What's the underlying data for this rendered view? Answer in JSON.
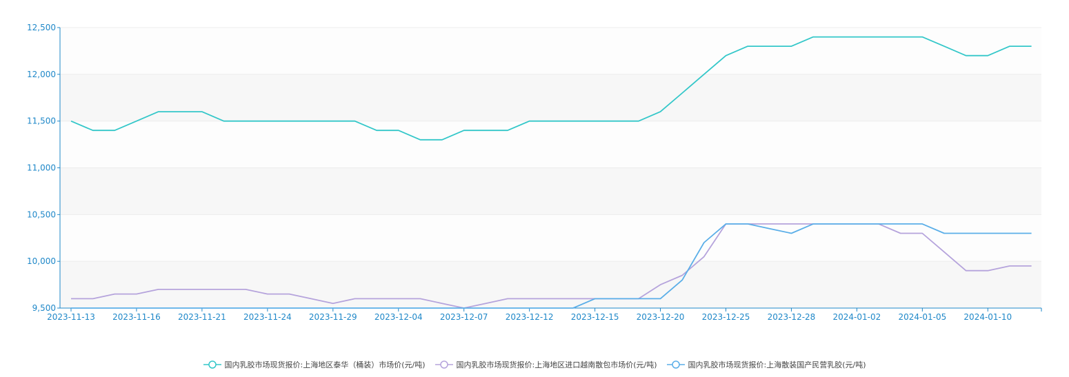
{
  "chart_data": {
    "type": "line",
    "x": [
      "2023-11-13",
      "2023-11-14",
      "2023-11-15",
      "2023-11-16",
      "2023-11-17",
      "2023-11-20",
      "2023-11-21",
      "2023-11-22",
      "2023-11-23",
      "2023-11-24",
      "2023-11-27",
      "2023-11-28",
      "2023-11-29",
      "2023-11-30",
      "2023-12-01",
      "2023-12-04",
      "2023-12-05",
      "2023-12-06",
      "2023-12-07",
      "2023-12-08",
      "2023-12-11",
      "2023-12-12",
      "2023-12-13",
      "2023-12-14",
      "2023-12-15",
      "2023-12-18",
      "2023-12-19",
      "2023-12-20",
      "2023-12-21",
      "2023-12-22",
      "2023-12-25",
      "2023-12-26",
      "2023-12-27",
      "2023-12-28",
      "2023-12-29",
      "2024-01-02",
      "2024-01-03",
      "2024-01-04",
      "2024-01-05",
      "2024-01-08",
      "2024-01-09",
      "2024-01-10",
      "2024-01-11",
      "2024-01-12"
    ],
    "x_tick_labels": [
      "2023-11-13",
      "2023-11-16",
      "2023-11-21",
      "2023-11-24",
      "2023-11-29",
      "2023-12-04",
      "2023-12-07",
      "2023-12-12",
      "2023-12-15",
      "2023-12-20",
      "2023-12-25",
      "2023-12-28",
      "2024-01-02",
      "2024-01-05",
      "2024-01-10"
    ],
    "x_tick_every": 3,
    "y_ticks": [
      "9,500",
      "10,000",
      "10,500",
      "11,000",
      "11,500",
      "12,000",
      "12,500"
    ],
    "ylim": [
      9500,
      12500
    ],
    "grid": true,
    "legend_position": "bottom",
    "series": [
      {
        "name": "国内乳胶市场现货报价:上海地区泰华（桶装）市场价(元/吨)",
        "color": "#33c7c9",
        "values": [
          11500,
          11400,
          11400,
          11500,
          11600,
          11600,
          11600,
          11500,
          11500,
          11500,
          11500,
          11500,
          11500,
          11500,
          11400,
          11400,
          11300,
          11300,
          11400,
          11400,
          11400,
          11500,
          11500,
          11500,
          11500,
          11500,
          11500,
          11600,
          11800,
          12000,
          12200,
          12300,
          12300,
          12300,
          12400,
          12400,
          12400,
          12400,
          12400,
          12400,
          12300,
          12200,
          12200,
          12300,
          12300
        ]
      },
      {
        "name": "国内乳胶市场现货报价:上海地区进口越南散包市场价(元/吨)",
        "color": "#b5a3dc",
        "values": [
          9600,
          9600,
          9650,
          9650,
          9700,
          9700,
          9700,
          9700,
          9700,
          9650,
          9650,
          9600,
          9550,
          9600,
          9600,
          9600,
          9600,
          9550,
          9500,
          9550,
          9600,
          9600,
          9600,
          9600,
          9600,
          9600,
          9600,
          9750,
          9850,
          10050,
          10400,
          10400,
          10400,
          10400,
          10400,
          10400,
          10400,
          10400,
          10300,
          10300,
          10100,
          9900,
          9900,
          9950,
          9950
        ]
      },
      {
        "name": "国内乳胶市场现货报价:上海散装国产民营乳胶(元/吨)",
        "color": "#5aaee8",
        "values": [
          9500,
          9500,
          9500,
          9500,
          9500,
          9500,
          9500,
          9500,
          9500,
          9500,
          9500,
          9500,
          9500,
          9500,
          9500,
          9500,
          9500,
          9500,
          9500,
          9500,
          9500,
          9500,
          9500,
          9500,
          9600,
          9600,
          9600,
          9600,
          9800,
          10200,
          10400,
          10400,
          10350,
          10300,
          10400,
          10400,
          10400,
          10400,
          10400,
          10400,
          10300,
          10300,
          10300,
          10300,
          10300
        ]
      }
    ]
  }
}
